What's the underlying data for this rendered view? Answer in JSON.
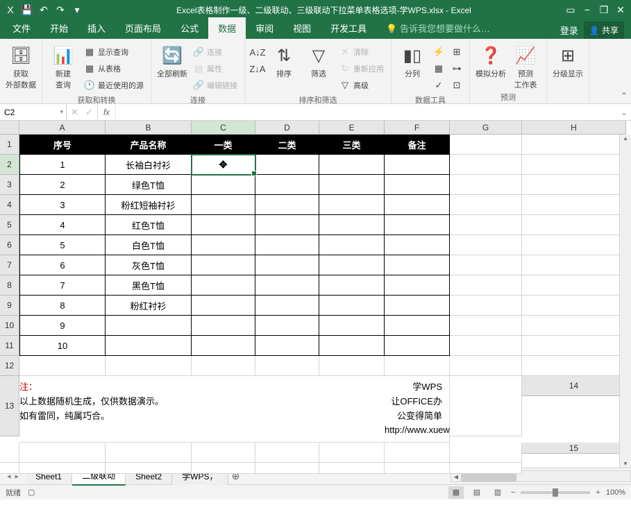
{
  "title": "Excel表格制作一级、二级联动、三级联动下拉菜单表格选项-学WPS.xlsx - Excel",
  "window_controls": {
    "help": "?",
    "min": "−",
    "restore": "❐",
    "close": "✕"
  },
  "qat": {
    "excel": "X",
    "save": "💾",
    "undo": "↶",
    "redo": "↷",
    "more": "▾"
  },
  "tabs": {
    "file": "文件",
    "home": "开始",
    "insert": "插入",
    "layout": "页面布局",
    "formula": "公式",
    "data": "数据",
    "review": "审阅",
    "view": "视图",
    "dev": "开发工具",
    "tellme": "告诉我您想要做什么…"
  },
  "login": "登录",
  "share": "共享",
  "ribbon": {
    "get_ext_data": "获取\n外部数据",
    "new_query": "新建\n查询",
    "show_query": "显示查询",
    "from_table": "从表格",
    "recent_src": "最近使用的源",
    "group1": "获取和转换",
    "refresh_all": "全部刷新",
    "connections": "连接",
    "properties": "属性",
    "edit_links": "编辑链接",
    "group2": "连接",
    "sort_az": "A↓Z",
    "sort_za": "Z↓A",
    "sort": "排序",
    "filter": "筛选",
    "clear": "清除",
    "reapply": "重新应用",
    "advanced": "高级",
    "group3": "排序和筛选",
    "text_to_col": "分列",
    "group4": "数据工具",
    "whatif": "模拟分析",
    "forecast": "预测\n工作表",
    "group5": "预测",
    "outline": "分级显示",
    "group6": ""
  },
  "namebox": "C2",
  "fx": "fx",
  "columns": [
    "A",
    "B",
    "C",
    "D",
    "E",
    "F",
    "G",
    "H"
  ],
  "headers": [
    "序号",
    "产品名称",
    "一类",
    "二类",
    "三类",
    "备注"
  ],
  "rows": [
    {
      "n": "1",
      "name": "长袖白衬衫"
    },
    {
      "n": "2",
      "name": "绿色T恤"
    },
    {
      "n": "3",
      "name": "粉红短袖衬衫"
    },
    {
      "n": "4",
      "name": "红色T恤"
    },
    {
      "n": "5",
      "name": "白色T恤"
    },
    {
      "n": "6",
      "name": "灰色T恤"
    },
    {
      "n": "7",
      "name": "黑色T恤"
    },
    {
      "n": "8",
      "name": "粉红衬衫"
    },
    {
      "n": "9",
      "name": ""
    },
    {
      "n": "10",
      "name": ""
    }
  ],
  "note_label": "注：",
  "note_line1": "以上数据随机生成，仅供数据演示。",
  "note_line2": "如有雷同，纯属巧合。",
  "info_line1": "学WPS",
  "info_line2": "让OFFICE办公变得简单",
  "info_line3": "http://www.xuewps.com/",
  "sheets": [
    "Sheet1",
    "二级联动",
    "Sheet2",
    "学WPS，"
  ],
  "active_sheet": 1,
  "status_ready": "就绪",
  "zoom": "100%"
}
